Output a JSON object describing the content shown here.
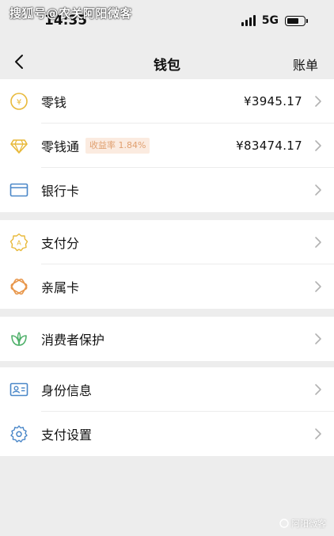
{
  "status_bar": {
    "time": "14:35",
    "network": "5G",
    "battery_level": 0.7
  },
  "watermark": {
    "top": "搜狐号@农关阿阳微客",
    "bottom": "阿阳微客"
  },
  "nav": {
    "back_icon": "chevron-left-icon",
    "title": "钱包",
    "right_label": "账单"
  },
  "groups": [
    {
      "items": [
        {
          "icon": "yuan-coin-icon",
          "label": "零钱",
          "value": "¥3945.17"
        },
        {
          "icon": "diamond-icon",
          "label": "零钱通",
          "badge": "收益率 1.84%",
          "value": "¥83474.17"
        },
        {
          "icon": "bank-card-icon",
          "label": "银行卡",
          "value": ""
        }
      ]
    },
    {
      "items": [
        {
          "icon": "pay-score-icon",
          "label": "支付分"
        },
        {
          "icon": "family-card-icon",
          "label": "亲属卡"
        }
      ]
    },
    {
      "items": [
        {
          "icon": "consumer-protection-icon",
          "label": "消费者保护"
        }
      ]
    },
    {
      "items": [
        {
          "icon": "id-card-icon",
          "label": "身份信息"
        },
        {
          "icon": "settings-gear-icon",
          "label": "支付设置"
        }
      ]
    }
  ],
  "colors": {
    "background": "#ededed",
    "badge_bg": "#fbebe0",
    "badge_text": "#e0a070",
    "gold_icon": "#e8b93a",
    "orange_icon": "#e8964a",
    "blue_icon": "#4a87c8",
    "green_icon": "#4fb06a"
  }
}
